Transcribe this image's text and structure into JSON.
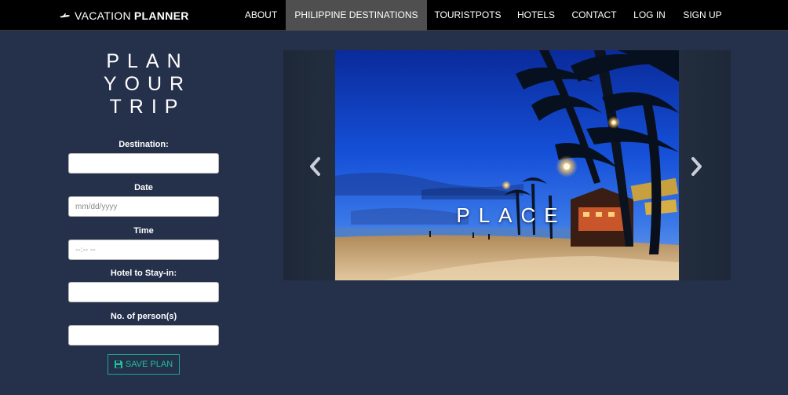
{
  "brand": {
    "part1": "VACATION",
    "part2": "PLANNER"
  },
  "nav": {
    "items": [
      {
        "label": "ABOUT",
        "active": false
      },
      {
        "label": "PHILIPPINE DESTINATIONS",
        "active": true
      },
      {
        "label": "TOURISTPOTS",
        "active": false
      },
      {
        "label": "HOTELS",
        "active": false
      },
      {
        "label": "CONTACT",
        "active": false
      },
      {
        "label": "LOG IN",
        "active": false
      },
      {
        "label": "SIGN UP",
        "active": false
      }
    ]
  },
  "plan": {
    "title_lines": [
      "PLAN",
      "YOUR",
      "TRIP"
    ],
    "fields": [
      {
        "label": "Destination:",
        "value": "",
        "placeholder": ""
      },
      {
        "label": "Date",
        "value": "",
        "placeholder": "mm/dd/yyyy"
      },
      {
        "label": "Time",
        "value": "",
        "placeholder": "--:-- --"
      },
      {
        "label": "Hotel to Stay-in:",
        "value": "",
        "placeholder": ""
      },
      {
        "label": "No. of person(s)",
        "value": "",
        "placeholder": ""
      }
    ],
    "save_label": "SAVE PLAN"
  },
  "carousel": {
    "caption": "PLACE",
    "prev_icon": "chevron-left-icon",
    "next_icon": "chevron-right-icon"
  },
  "colors": {
    "page_bg": "#25304a",
    "navbar_bg": "#000000",
    "nav_active_bg": "#4f4f4f",
    "accent": "#1fbf9c"
  }
}
